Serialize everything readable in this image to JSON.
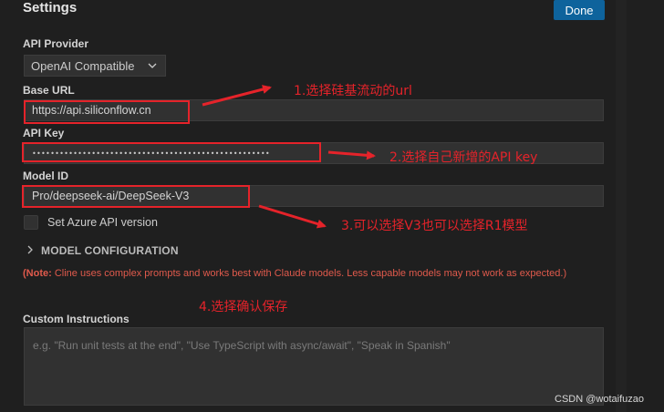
{
  "settings": {
    "title": "Settings",
    "done_label": "Done"
  },
  "api_provider": {
    "label": "API Provider",
    "selected": "OpenAI Compatible"
  },
  "base_url": {
    "label": "Base URL",
    "value": "https://api.siliconflow.cn"
  },
  "api_key": {
    "label": "API Key",
    "value": "••••••••••••••••••••••••••••••••••••••••••••••••••••"
  },
  "model_id": {
    "label": "Model ID",
    "value": "Pro/deepseek-ai/DeepSeek-V3"
  },
  "azure": {
    "label": "Set Azure API version",
    "checked": false
  },
  "model_config": {
    "label": "MODEL CONFIGURATION"
  },
  "note": {
    "prefix": "(Note:",
    "text": " Cline uses complex prompts and works best with Claude models. Less capable models may not work as expected.)"
  },
  "custom_instructions": {
    "label": "Custom Instructions",
    "placeholder": "e.g. \"Run unit tests at the end\", \"Use TypeScript with async/await\", \"Speak in Spanish\""
  },
  "annotations": {
    "a1": "1.选择硅基流动的url",
    "a2": "2.选择自己新增的API key",
    "a3": "3.可以选择V3也可以选择R1模型",
    "a4": "4.选择确认保存",
    "color": "#e5232a"
  },
  "watermark": "CSDN @wotaifuzao",
  "colors": {
    "background": "#1f1f1f",
    "input_bg": "#313131",
    "button": "#0e639c",
    "note": "#e05a4c"
  }
}
